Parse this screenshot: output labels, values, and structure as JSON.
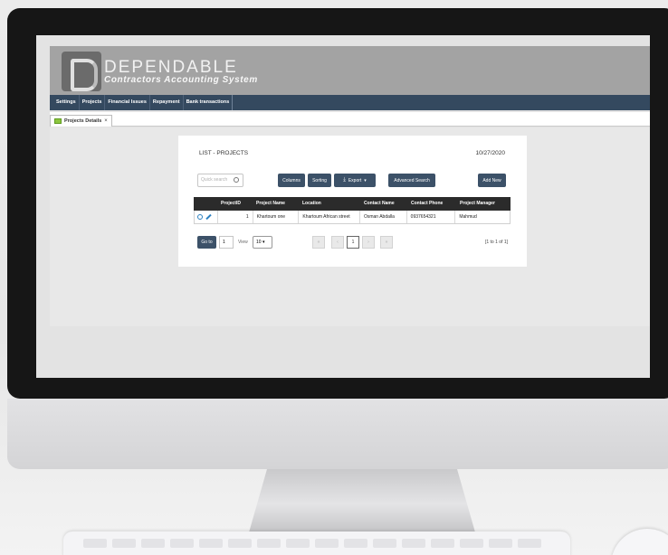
{
  "brand": {
    "name": "DEPENDABLE",
    "subtitle": "Contractors Accounting System"
  },
  "nav": {
    "items": [
      "Settings",
      "Projects",
      "Financial Issues",
      "Repayment",
      "Bank transactions"
    ]
  },
  "tabs": [
    {
      "label": "Projects Details",
      "close": "×"
    }
  ],
  "list": {
    "title": "LIST - PROJECTS",
    "date": "10/27/2020",
    "search_placeholder": "Quick search",
    "buttons": {
      "columns": "Columns",
      "sorting": "Sorting",
      "export": "Export",
      "advanced_search": "Advanced Search",
      "add_new": "Add New"
    }
  },
  "table": {
    "columns": [
      "",
      "ProjectID",
      "Project Name",
      "Location",
      "Contact Name",
      "Contact Phone",
      "Project Manager"
    ],
    "rows": [
      {
        "project_id": "1",
        "project_name": "Khartoum one",
        "location": "Khartoum African street",
        "contact_name": "Osman Abdalla",
        "contact_phone": "0937654321",
        "project_manager": "Mahmud"
      }
    ]
  },
  "pager": {
    "goto_label": "Go to",
    "goto_value": "1",
    "view_label": "View",
    "view_value": "10",
    "first": "«",
    "prev": "‹",
    "current_page": "1",
    "next": "›",
    "last": "»",
    "info": "[1 to 1 of 1]"
  }
}
